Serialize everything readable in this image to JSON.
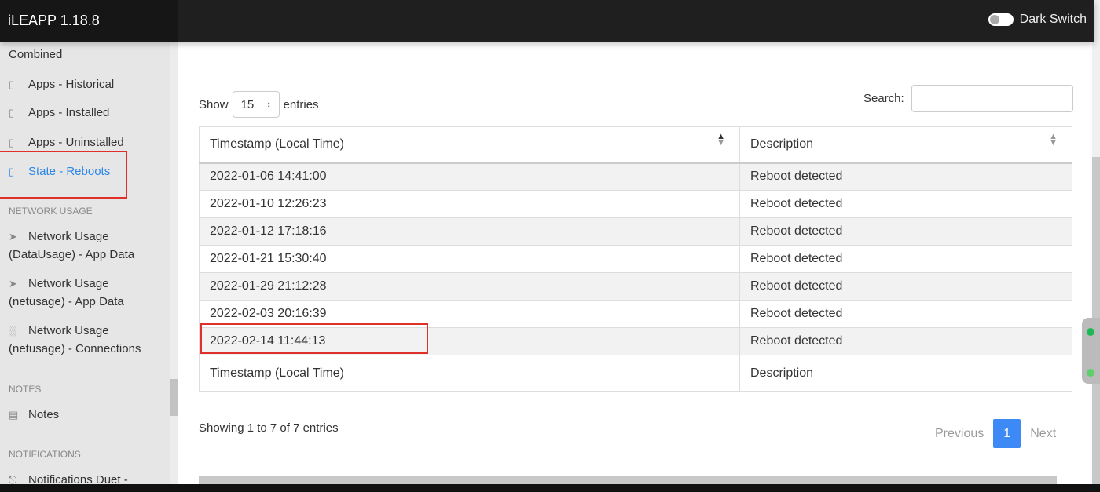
{
  "app": {
    "title": "iLEAPP 1.18.8",
    "dark_switch_label": "Dark Switch"
  },
  "sidebar": {
    "items": [
      {
        "label": "Combined",
        "icon": "clipboard-icon"
      },
      {
        "label": "Apps - Historical",
        "icon": "clipboard-icon"
      },
      {
        "label": "Apps - Installed",
        "icon": "clipboard-icon"
      },
      {
        "label": "Apps - Uninstalled",
        "icon": "clipboard-icon"
      },
      {
        "label": "State - Reboots",
        "icon": "clipboard-icon",
        "active": true
      }
    ],
    "sections": [
      {
        "title": "NETWORK USAGE",
        "items": [
          {
            "line1": "Network Usage",
            "line2": "(DataUsage) - App Data",
            "icon": "send-icon"
          },
          {
            "line1": "Network Usage",
            "line2": "(netusage) - App Data",
            "icon": "send-icon"
          },
          {
            "line1": "Network Usage",
            "line2": "(netusage) - Connections",
            "icon": "bar-chart-icon"
          }
        ]
      },
      {
        "title": "NOTES",
        "items": [
          {
            "label": "Notes",
            "icon": "file-text-icon"
          }
        ]
      },
      {
        "title": "NOTIFICATIONS",
        "items": [
          {
            "label": "Notifications Duet -",
            "icon": "bell-icon"
          }
        ]
      }
    ]
  },
  "controls": {
    "show_label": "Show",
    "entries_value": "15",
    "entries_label": "entries",
    "search_label": "Search:",
    "search_value": ""
  },
  "table": {
    "columns": [
      "Timestamp (Local Time)",
      "Description"
    ],
    "rows": [
      [
        "2022-01-06 14:41:00",
        "Reboot detected"
      ],
      [
        "2022-01-10 12:26:23",
        "Reboot detected"
      ],
      [
        "2022-01-12 17:18:16",
        "Reboot detected"
      ],
      [
        "2022-01-21 15:30:40",
        "Reboot detected"
      ],
      [
        "2022-01-29 21:12:28",
        "Reboot detected"
      ],
      [
        "2022-02-03 20:16:39",
        "Reboot detected"
      ],
      [
        "2022-02-14 11:44:13",
        "Reboot detected"
      ]
    ]
  },
  "footer": {
    "info": "Showing 1 to 7 of 7 entries",
    "previous": "Previous",
    "page": "1",
    "next": "Next"
  },
  "colors": {
    "accent": "#3d8af7",
    "active": "#2c87e8",
    "highlight": "#e0302a"
  }
}
